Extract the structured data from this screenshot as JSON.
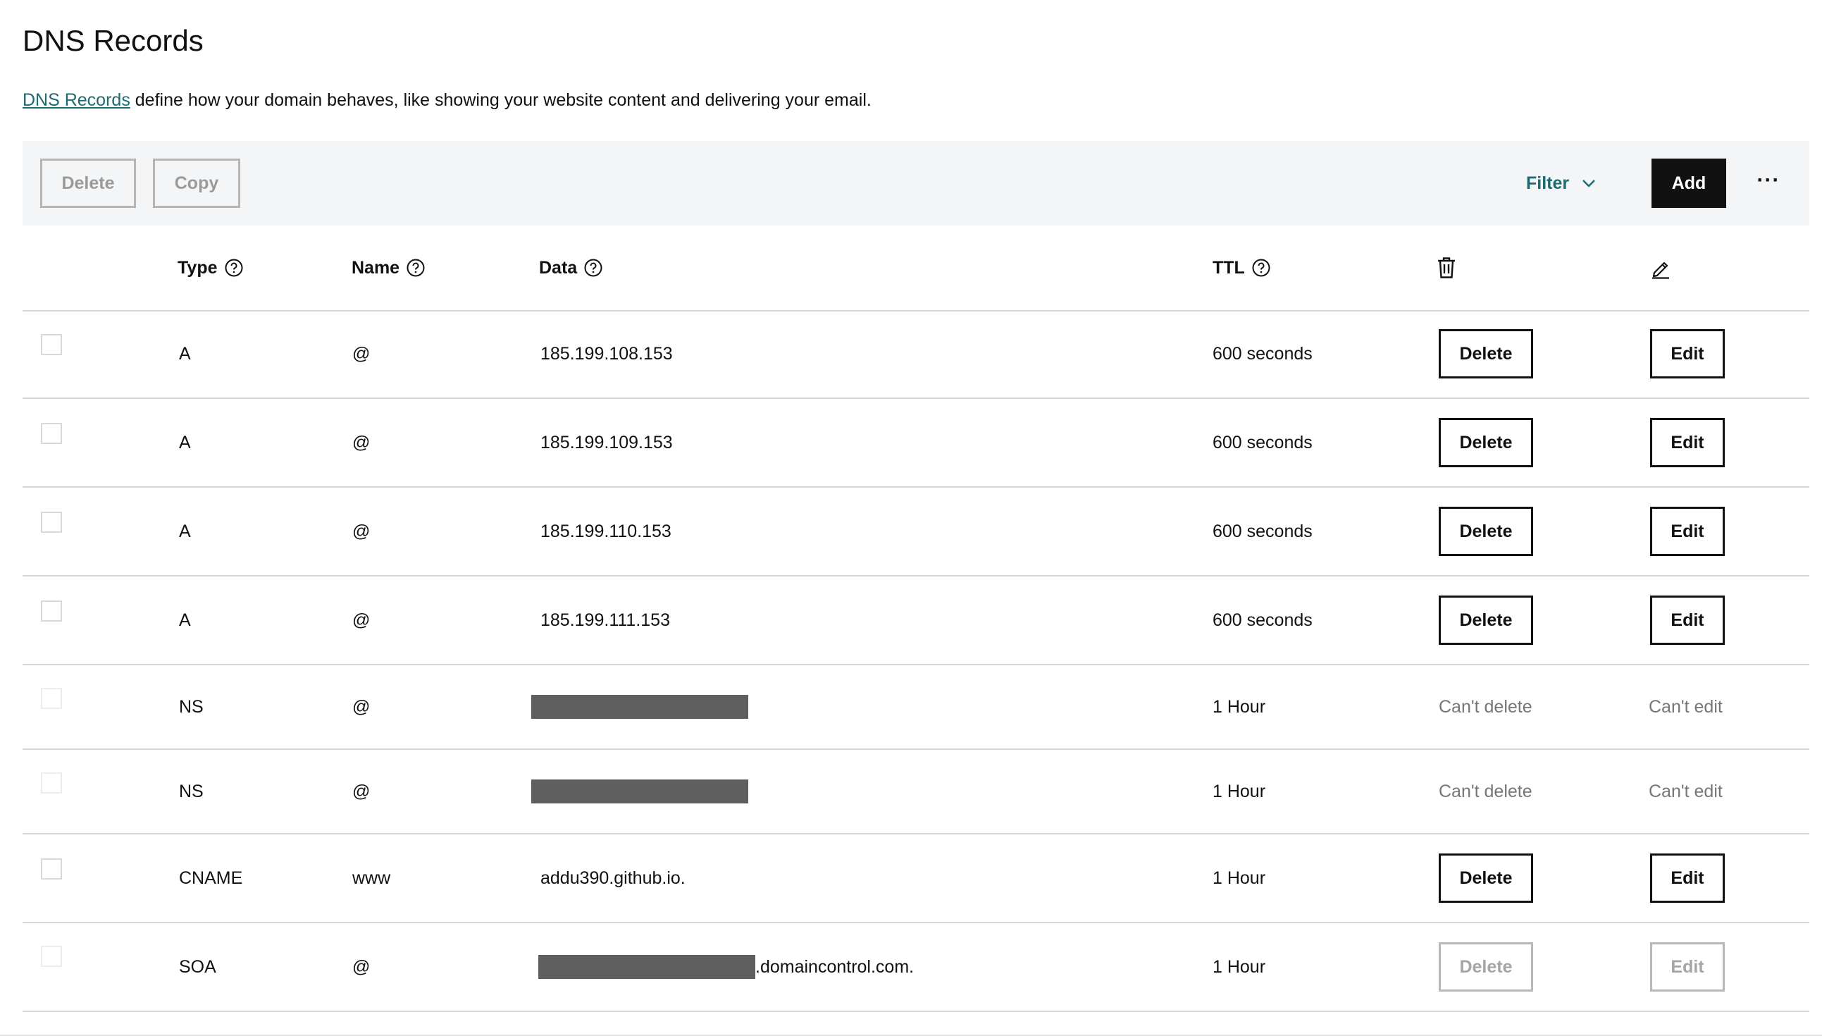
{
  "page": {
    "title": "DNS Records",
    "description_link": "DNS Records",
    "description_rest": " define how your domain behaves, like showing your website content and delivering your email."
  },
  "toolbar": {
    "delete_label": "Delete",
    "copy_label": "Copy",
    "filter_label": "Filter",
    "add_label": "Add",
    "more_label": "···"
  },
  "table": {
    "headers": {
      "type": "Type",
      "name": "Name",
      "data": "Data",
      "ttl": "TTL"
    },
    "rows": [
      {
        "type": "A",
        "name": "@",
        "data": "185.199.108.153",
        "ttl": "600 seconds",
        "delete": "Delete",
        "edit": "Edit",
        "editable": true
      },
      {
        "type": "A",
        "name": "@",
        "data": "185.199.109.153",
        "ttl": "600 seconds",
        "delete": "Delete",
        "edit": "Edit",
        "editable": true
      },
      {
        "type": "A",
        "name": "@",
        "data": "185.199.110.153",
        "ttl": "600 seconds",
        "delete": "Delete",
        "edit": "Edit",
        "editable": true
      },
      {
        "type": "A",
        "name": "@",
        "data": "185.199.111.153",
        "ttl": "600 seconds",
        "delete": "Delete",
        "edit": "Edit",
        "editable": true
      },
      {
        "type": "NS",
        "name": "@",
        "data": "",
        "ttl": "1 Hour",
        "delete": "Can't delete",
        "edit": "Can't edit",
        "editable": false
      },
      {
        "type": "NS",
        "name": "@",
        "data": "",
        "ttl": "1 Hour",
        "delete": "Can't delete",
        "edit": "Can't edit",
        "editable": false
      },
      {
        "type": "CNAME",
        "name": "www",
        "data": "addu390.github.io.",
        "ttl": "1 Hour",
        "delete": "Delete",
        "edit": "Edit",
        "editable": true
      },
      {
        "type": "SOA",
        "name": "@",
        "data": ".domaincontrol.com.",
        "ttl": "1 Hour",
        "delete": "Delete",
        "edit": "Edit",
        "editable": false
      }
    ]
  },
  "colors": {
    "link": "#1b6b73",
    "toolbar_bg": "#f4f5f6",
    "primary_button": "#111111",
    "redaction": "#5f5f5f"
  },
  "icons": {
    "help": "help-circle-icon",
    "delete_column": "trash-icon",
    "edit_column": "pencil-icon",
    "filter": "chevron-down-icon"
  }
}
